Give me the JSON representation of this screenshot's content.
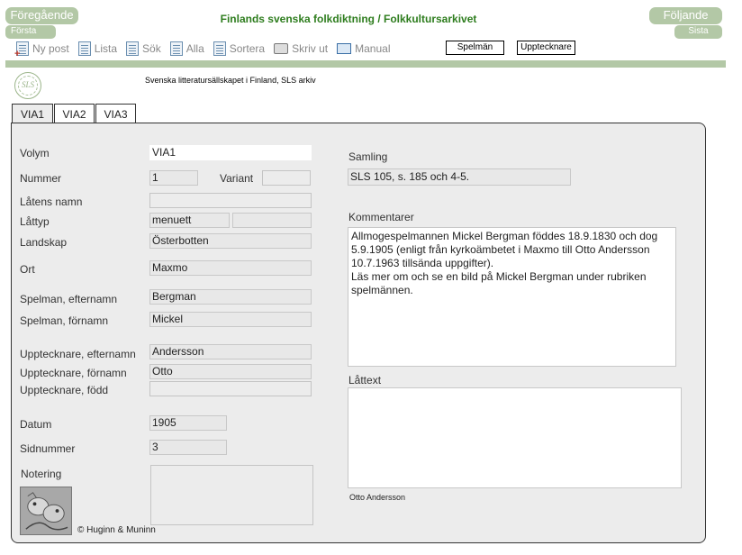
{
  "nav": {
    "prev_label": "Föregående",
    "first_label": "Första",
    "next_label": "Följande",
    "last_label": "Sista",
    "title": "Finlands svenska folkdiktning / Folkkultursarkivet"
  },
  "toolbar": {
    "items": [
      {
        "label": "Ny post",
        "icon": "new-post-icon"
      },
      {
        "label": "Lista",
        "icon": "list-icon"
      },
      {
        "label": "Sök",
        "icon": "search-doc-icon"
      },
      {
        "label": "Alla",
        "icon": "all-icon"
      },
      {
        "label": "Sortera",
        "icon": "sort-icon"
      },
      {
        "label": "Skriv ut",
        "icon": "printer-icon"
      },
      {
        "label": "Manual",
        "icon": "book-icon"
      }
    ],
    "spelman_label": "Spelmän",
    "upptecknare_label": "Upptecknare"
  },
  "header": {
    "logo_text": "SLS",
    "subtitle": "Svenska litteratursällskapet i Finland, SLS arkiv"
  },
  "tabs": [
    "VIA1",
    "VIA2",
    "VIA3"
  ],
  "form": {
    "volym": {
      "label": "Volym",
      "value": "VIA1"
    },
    "nummer": {
      "label": "Nummer",
      "value": "1"
    },
    "variant": {
      "label": "Variant",
      "value": ""
    },
    "latens_namn": {
      "label": "Låtens namn",
      "value": ""
    },
    "lattyp": {
      "label": "Låttyp",
      "value": "menuett",
      "value2": ""
    },
    "landskap": {
      "label": "Landskap",
      "value": "Österbotten"
    },
    "ort": {
      "label": "Ort",
      "value": "Maxmo"
    },
    "spelman_efternamn": {
      "label": "Spelman, efternamn",
      "value": "Bergman"
    },
    "spelman_fornamn": {
      "label": "Spelman, förnamn",
      "value": "Mickel"
    },
    "upptecknare_efternamn": {
      "label": "Upptecknare, efternamn",
      "value": "Andersson"
    },
    "upptecknare_fornamn": {
      "label": "Upptecknare, förnamn",
      "value": "Otto"
    },
    "upptecknare_fodd": {
      "label": "Upptecknare, född",
      "value": ""
    },
    "datum": {
      "label": "Datum",
      "value": "1905"
    },
    "sidnummer": {
      "label": "Sidnummer",
      "value": "3"
    },
    "notering": {
      "label": "Notering",
      "value": ""
    },
    "samling": {
      "label": "Samling",
      "value": "SLS 105, s. 185 och 4-5."
    },
    "kommentarer": {
      "label": "Kommentarer",
      "value": "Allmogespelmannen Mickel Bergman föddes 18.9.1830 och dog 5.9.1905 (enligt från kyrkoämbetet i Maxmo till Otto Andersson 10.7.1963 tillsända uppgifter).\nLäs mer om och se en bild på Mickel Bergman under rubriken spelmännen."
    },
    "lattext": {
      "label": "Låttext",
      "value": ""
    },
    "lattext_caption": "Otto Andersson"
  },
  "footer": {
    "copyright": "© Huginn & Muninn"
  }
}
